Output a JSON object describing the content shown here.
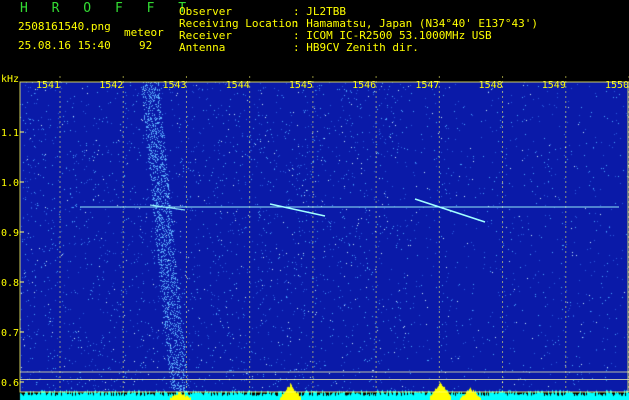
{
  "header": {
    "app_name": "H R O F F T",
    "filename": "2508161540.png",
    "datetime": "25.08.16 15:40",
    "counter_label": "meteor",
    "counter_value": "92",
    "info": [
      {
        "label": "Observer",
        "value": ": JL2TBB"
      },
      {
        "label": "Receiving Location",
        "value": ": Hamamatsu, Japan (N34°40' E137°43')"
      },
      {
        "label": "Receiver",
        "value": ": ICOM IC-R2500 53.1000MHz USB"
      },
      {
        "label": "Antenna",
        "value": ": HB9CV Zenith dir."
      }
    ]
  },
  "chart_data": {
    "type": "heatmap",
    "title": "",
    "xlabel": "",
    "ylabel": "kHz",
    "x_ticks": [
      "1541",
      "1542",
      "1543",
      "1544",
      "1545",
      "1546",
      "1547",
      "1548",
      "1549",
      "1550"
    ],
    "y_ticks": [
      "1.1",
      "1.0",
      "0.9",
      "0.8",
      "0.7",
      "0.6"
    ],
    "ylim": [
      0.58,
      1.2
    ],
    "carrier_line_khz": 0.95,
    "colors": {
      "background": "#0a1aa8",
      "noise": "#4aa8ff",
      "grid": "#ffff66",
      "signal": "#a0ffff",
      "bottom_level": "#00ffff",
      "peak": "#ffff00"
    }
  }
}
